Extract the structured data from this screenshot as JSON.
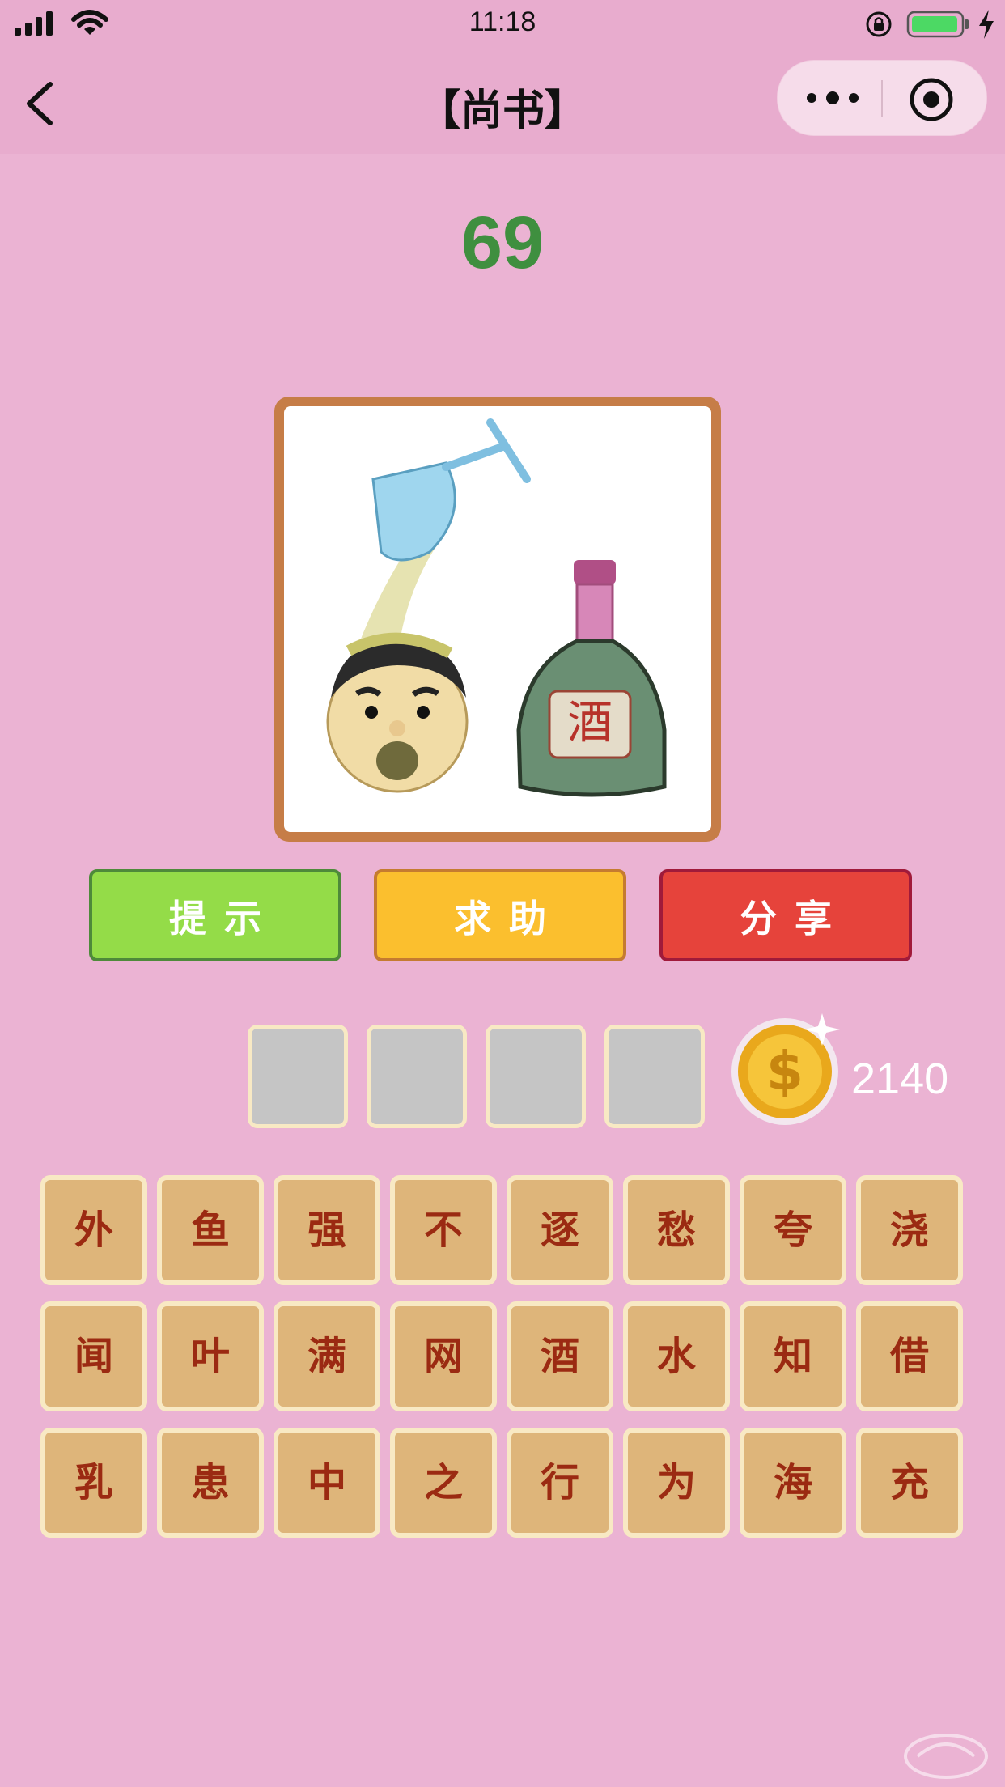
{
  "status_bar": {
    "time": "11:18"
  },
  "nav": {
    "title": "【尚书】"
  },
  "level": "69",
  "puzzle_image": {
    "label_on_bottle": "酒"
  },
  "buttons": {
    "hint": "提示",
    "help": "求助",
    "share": "分享"
  },
  "answer_slots": [
    "",
    "",
    "",
    ""
  ],
  "coins": "2140",
  "letter_grid": [
    [
      "外",
      "鱼",
      "强",
      "不",
      "逐",
      "愁",
      "夸",
      "浇"
    ],
    [
      "闻",
      "叶",
      "满",
      "网",
      "酒",
      "水",
      "知",
      "借"
    ],
    [
      "乳",
      "患",
      "中",
      "之",
      "行",
      "为",
      "海",
      "充"
    ]
  ],
  "colors": {
    "background": "#ebb3d3",
    "level_text": "#3f8f3f",
    "hint_button": "#94dc48",
    "help_button": "#fbbf2e",
    "share_button": "#e6433b",
    "tile": "#deb57a",
    "tile_text": "#9b2a12"
  }
}
